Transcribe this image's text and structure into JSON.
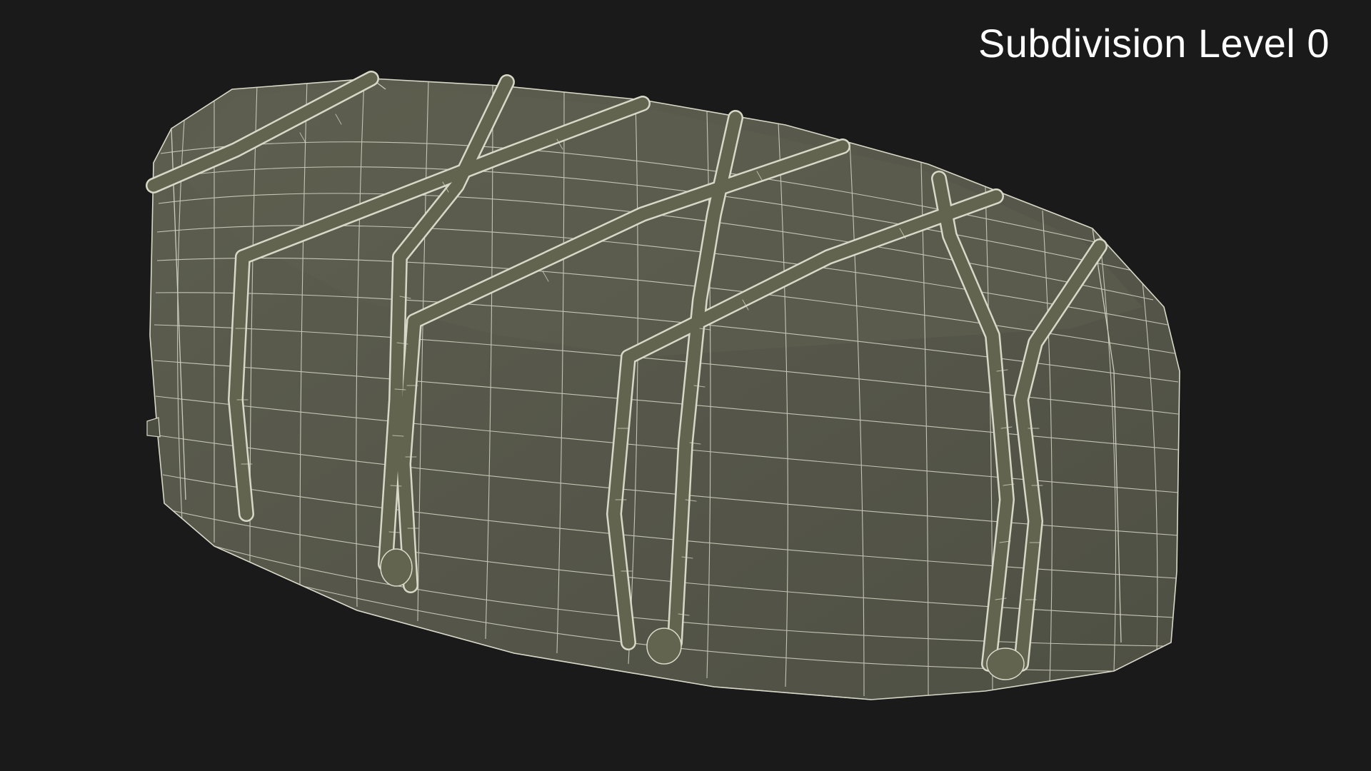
{
  "viewport": {
    "label": "Subdivision Level 0",
    "background_color": "#1a1a1a",
    "label_color": "#ffffff"
  },
  "model": {
    "surface_color": "#575848",
    "wire_color": "#d8d8c8",
    "rope_color": "#63644f"
  }
}
